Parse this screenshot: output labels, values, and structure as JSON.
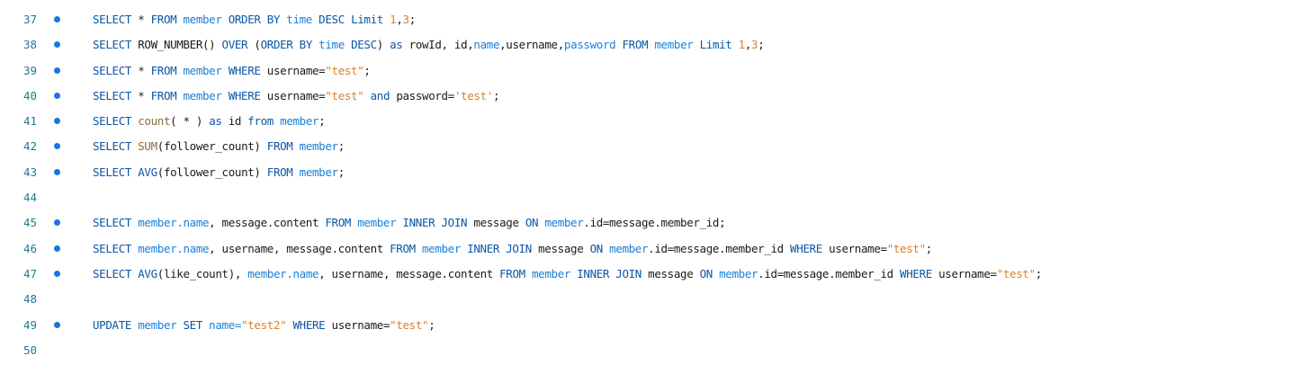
{
  "colors": {
    "line_number": "#237893",
    "breakpoint": "#1a73e8",
    "keyword": "#0b57a6",
    "identifier": "#1a1a1a",
    "function": "#8a6d3b",
    "number": "#d9822b",
    "string": "#d9822b",
    "object": "#1a7fd9"
  },
  "lines": [
    {
      "num": "37",
      "bp": true,
      "tokens": [
        {
          "t": "SELECT",
          "c": "kw"
        },
        {
          "t": " * ",
          "c": "op"
        },
        {
          "t": "FROM",
          "c": "kw"
        },
        {
          "t": " member ",
          "c": "obj"
        },
        {
          "t": "ORDER BY",
          "c": "kw"
        },
        {
          "t": " time ",
          "c": "obj"
        },
        {
          "t": "DESC",
          "c": "kw"
        },
        {
          "t": " ",
          "c": "op"
        },
        {
          "t": "Limit",
          "c": "kw"
        },
        {
          "t": " ",
          "c": "op"
        },
        {
          "t": "1",
          "c": "num"
        },
        {
          "t": ",",
          "c": "op"
        },
        {
          "t": "3",
          "c": "num"
        },
        {
          "t": ";",
          "c": "op"
        }
      ]
    },
    {
      "num": "38",
      "bp": true,
      "tokens": [
        {
          "t": "SELECT",
          "c": "kw"
        },
        {
          "t": " ROW_NUMBER() ",
          "c": "id"
        },
        {
          "t": "OVER",
          "c": "kw"
        },
        {
          "t": " (",
          "c": "op"
        },
        {
          "t": "ORDER BY",
          "c": "kw"
        },
        {
          "t": " time ",
          "c": "obj"
        },
        {
          "t": "DESC",
          "c": "kw"
        },
        {
          "t": ") ",
          "c": "op"
        },
        {
          "t": "as",
          "c": "kw"
        },
        {
          "t": " rowId, id,",
          "c": "id"
        },
        {
          "t": "name",
          "c": "obj"
        },
        {
          "t": ",username,",
          "c": "id"
        },
        {
          "t": "password",
          "c": "obj"
        },
        {
          "t": " ",
          "c": "op"
        },
        {
          "t": "FROM",
          "c": "kw"
        },
        {
          "t": " member ",
          "c": "obj"
        },
        {
          "t": "Limit",
          "c": "kw"
        },
        {
          "t": " ",
          "c": "op"
        },
        {
          "t": "1",
          "c": "num"
        },
        {
          "t": ",",
          "c": "op"
        },
        {
          "t": "3",
          "c": "num"
        },
        {
          "t": ";",
          "c": "op"
        }
      ]
    },
    {
      "num": "39",
      "bp": true,
      "tokens": [
        {
          "t": "SELECT",
          "c": "kw"
        },
        {
          "t": " * ",
          "c": "op"
        },
        {
          "t": "FROM",
          "c": "kw"
        },
        {
          "t": " member ",
          "c": "obj"
        },
        {
          "t": "WHERE",
          "c": "kw"
        },
        {
          "t": " username=",
          "c": "id"
        },
        {
          "t": "\"test\"",
          "c": "str"
        },
        {
          "t": ";",
          "c": "op"
        }
      ]
    },
    {
      "num": "40",
      "bp": true,
      "tokens": [
        {
          "t": "SELECT",
          "c": "kw"
        },
        {
          "t": " * ",
          "c": "op"
        },
        {
          "t": "FROM",
          "c": "kw"
        },
        {
          "t": " member ",
          "c": "obj"
        },
        {
          "t": "WHERE",
          "c": "kw"
        },
        {
          "t": " username=",
          "c": "id"
        },
        {
          "t": "\"test\"",
          "c": "str"
        },
        {
          "t": " ",
          "c": "op"
        },
        {
          "t": "and",
          "c": "kw"
        },
        {
          "t": " password=",
          "c": "id"
        },
        {
          "t": "'test'",
          "c": "str"
        },
        {
          "t": ";",
          "c": "op"
        }
      ]
    },
    {
      "num": "41",
      "bp": true,
      "tokens": [
        {
          "t": "SELECT",
          "c": "kw"
        },
        {
          "t": " ",
          "c": "op"
        },
        {
          "t": "count",
          "c": "fn"
        },
        {
          "t": "( * ) ",
          "c": "op"
        },
        {
          "t": "as",
          "c": "kw"
        },
        {
          "t": " id ",
          "c": "id"
        },
        {
          "t": "from",
          "c": "kw"
        },
        {
          "t": " member",
          "c": "obj"
        },
        {
          "t": ";",
          "c": "op"
        }
      ]
    },
    {
      "num": "42",
      "bp": true,
      "tokens": [
        {
          "t": "SELECT",
          "c": "kw"
        },
        {
          "t": " ",
          "c": "op"
        },
        {
          "t": "SUM",
          "c": "fn"
        },
        {
          "t": "(follower_count) ",
          "c": "id"
        },
        {
          "t": "FROM",
          "c": "kw"
        },
        {
          "t": " member",
          "c": "obj"
        },
        {
          "t": ";",
          "c": "op"
        }
      ]
    },
    {
      "num": "43",
      "bp": true,
      "tokens": [
        {
          "t": "SELECT",
          "c": "kw"
        },
        {
          "t": " ",
          "c": "op"
        },
        {
          "t": "AVG",
          "c": "kw"
        },
        {
          "t": "(follower_count) ",
          "c": "id"
        },
        {
          "t": "FROM",
          "c": "kw"
        },
        {
          "t": " member",
          "c": "obj"
        },
        {
          "t": ";",
          "c": "op"
        }
      ]
    },
    {
      "num": "44",
      "bp": false,
      "tokens": []
    },
    {
      "num": "45",
      "bp": true,
      "tokens": [
        {
          "t": "SELECT",
          "c": "kw"
        },
        {
          "t": " member.",
          "c": "obj"
        },
        {
          "t": "name",
          "c": "obj"
        },
        {
          "t": ", message.content ",
          "c": "id"
        },
        {
          "t": "FROM",
          "c": "kw"
        },
        {
          "t": " member ",
          "c": "obj"
        },
        {
          "t": "INNER JOIN",
          "c": "kw"
        },
        {
          "t": " message ",
          "c": "id"
        },
        {
          "t": "ON",
          "c": "kw"
        },
        {
          "t": " member",
          "c": "obj"
        },
        {
          "t": ".id=message.member_id;",
          "c": "id"
        }
      ]
    },
    {
      "num": "46",
      "bp": true,
      "tokens": [
        {
          "t": "SELECT",
          "c": "kw"
        },
        {
          "t": " member.",
          "c": "obj"
        },
        {
          "t": "name",
          "c": "obj"
        },
        {
          "t": ", username, message.content ",
          "c": "id"
        },
        {
          "t": "FROM",
          "c": "kw"
        },
        {
          "t": " member ",
          "c": "obj"
        },
        {
          "t": "INNER JOIN",
          "c": "kw"
        },
        {
          "t": " message ",
          "c": "id"
        },
        {
          "t": "ON",
          "c": "kw"
        },
        {
          "t": " member",
          "c": "obj"
        },
        {
          "t": ".id=message.member_id ",
          "c": "id"
        },
        {
          "t": "WHERE",
          "c": "kw"
        },
        {
          "t": " username=",
          "c": "id"
        },
        {
          "t": "\"test\"",
          "c": "str"
        },
        {
          "t": ";",
          "c": "op"
        }
      ]
    },
    {
      "num": "47",
      "bp": true,
      "tokens": [
        {
          "t": "SELECT",
          "c": "kw"
        },
        {
          "t": " ",
          "c": "op"
        },
        {
          "t": "AVG",
          "c": "kw"
        },
        {
          "t": "(like_count), ",
          "c": "id"
        },
        {
          "t": "member.",
          "c": "obj"
        },
        {
          "t": "name",
          "c": "obj"
        },
        {
          "t": ", username, message.content ",
          "c": "id"
        },
        {
          "t": "FROM",
          "c": "kw"
        },
        {
          "t": " member ",
          "c": "obj"
        },
        {
          "t": "INNER JOIN",
          "c": "kw"
        },
        {
          "t": " message ",
          "c": "id"
        },
        {
          "t": "ON",
          "c": "kw"
        },
        {
          "t": " member",
          "c": "obj"
        },
        {
          "t": ".id=message.member_id ",
          "c": "id"
        },
        {
          "t": "WHERE",
          "c": "kw"
        },
        {
          "t": " username=",
          "c": "id"
        },
        {
          "t": "\"test\"",
          "c": "str"
        },
        {
          "t": ";",
          "c": "op"
        }
      ]
    },
    {
      "num": "48",
      "bp": false,
      "tokens": []
    },
    {
      "num": "49",
      "bp": true,
      "tokens": [
        {
          "t": "UPDATE",
          "c": "kw"
        },
        {
          "t": " member ",
          "c": "obj"
        },
        {
          "t": "SET",
          "c": "kw"
        },
        {
          "t": " name=",
          "c": "obj"
        },
        {
          "t": "\"test2\"",
          "c": "str"
        },
        {
          "t": " ",
          "c": "op"
        },
        {
          "t": "WHERE",
          "c": "kw"
        },
        {
          "t": " username=",
          "c": "id"
        },
        {
          "t": "\"test\"",
          "c": "str"
        },
        {
          "t": ";",
          "c": "op"
        }
      ]
    },
    {
      "num": "50",
      "bp": false,
      "tokens": []
    }
  ]
}
